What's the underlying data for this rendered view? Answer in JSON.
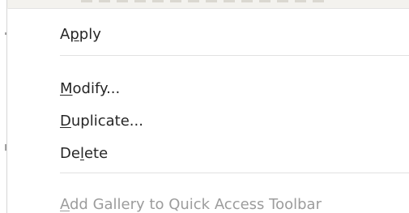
{
  "context_menu": {
    "items": [
      {
        "pre": "A",
        "accel": "p",
        "post": "ply",
        "enabled": true
      },
      {
        "pre": "",
        "accel": "M",
        "post": "odify...",
        "enabled": true
      },
      {
        "pre": "",
        "accel": "D",
        "post": "uplicate...",
        "enabled": true
      },
      {
        "pre": "De",
        "accel": "l",
        "post": "ete",
        "enabled": true
      },
      {
        "pre": "",
        "accel": "A",
        "post": "dd Gallery to Quick Access Toolbar",
        "enabled": false
      }
    ]
  }
}
